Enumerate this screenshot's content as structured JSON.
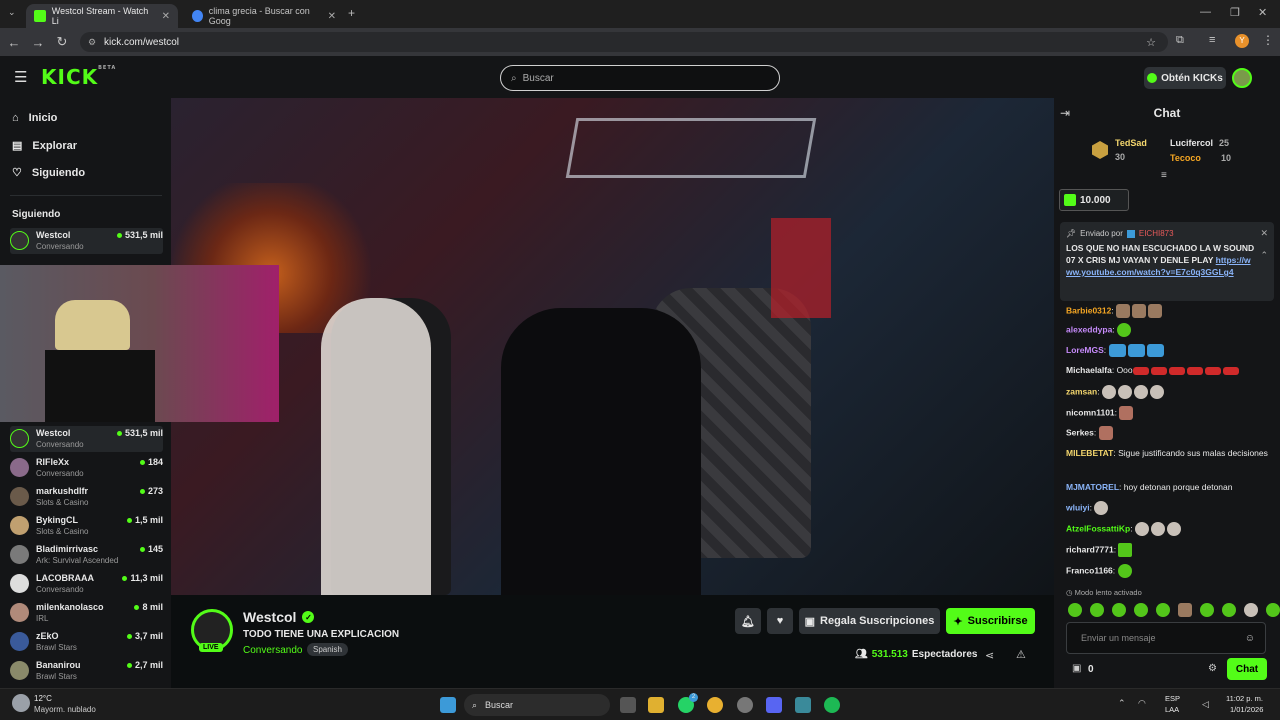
{
  "browser": {
    "tabs": [
      {
        "title": "Westcol Stream - Watch Li",
        "active": true
      },
      {
        "title": "clima grecia - Buscar con Goog",
        "active": false
      }
    ],
    "url": "kick.com/westcol",
    "profile_initial": "Y"
  },
  "header": {
    "logo": "KICK",
    "logo_badge": "BETA",
    "search_placeholder": "Buscar",
    "get_kicks": "Obtén KICKs"
  },
  "sidebar": {
    "nav": [
      {
        "label": "Inicio",
        "icon": "home-icon"
      },
      {
        "label": "Explorar",
        "icon": "compass-icon"
      },
      {
        "label": "Siguiendo",
        "icon": "heart-icon"
      }
    ],
    "following_header": "Siguiendo",
    "following": [
      {
        "name": "Westcol",
        "category": "Conversando",
        "viewers": "531,5 mil"
      },
      {
        "name": "Westcol",
        "category": "Conversando",
        "viewers": "531,5 mil"
      },
      {
        "name": "RIFleXx",
        "category": "Conversando",
        "viewers": "184"
      },
      {
        "name": "markushdlfr",
        "category": "Slots & Casino",
        "viewers": "273"
      },
      {
        "name": "BykingCL",
        "category": "Slots & Casino",
        "viewers": "1,5 mil"
      },
      {
        "name": "Bladimirrivasc",
        "category": "Ark: Survival Ascended",
        "viewers": "145"
      },
      {
        "name": "LACOBRAAA",
        "category": "Conversando",
        "viewers": "11,3 mil"
      },
      {
        "name": "milenkanolasco",
        "category": "IRL",
        "viewers": "8 mil"
      },
      {
        "name": "zEkO",
        "category": "Brawl Stars",
        "viewers": "3,7 mil"
      },
      {
        "name": "Bananirou",
        "category": "Brawl Stars",
        "viewers": "2,7 mil"
      }
    ]
  },
  "stream": {
    "streamer": "Westcol",
    "live": "LIVE",
    "title": "TODO TIENE UNA EXPLICACION",
    "category": "Conversando",
    "tag": "Spanish",
    "gift_subs": "Regala Suscripciones",
    "subscribe": "Suscribirse",
    "viewers": "531.513",
    "viewers_label": "Espectadores"
  },
  "chat": {
    "title": "Chat",
    "leaderboard": [
      {
        "name": "TedSad",
        "count": "30"
      },
      {
        "name": "Lucifercol",
        "count": "25"
      },
      {
        "name": "Tecoco",
        "count": "10"
      }
    ],
    "kicks_amount": "10.000",
    "pinned": {
      "by_label": "Enviado por",
      "user": "EICHI873",
      "text": "LOS QUE NO HAN ESCUCHADO LA W SOUND 07 X CRIS MJ VAYAN Y DENLE PLAY",
      "link": "https://www.youtube.com/watch?v=E7c0q3GGLg4"
    },
    "messages": [
      {
        "user": "Barbie0312",
        "color": "#f5a623",
        "text": "",
        "emotes": 3
      },
      {
        "user": "alexeddypa",
        "color": "#c58af9",
        "text": "",
        "emotes": 1
      },
      {
        "user": "LoreMGS",
        "color": "#c58af9",
        "text": "",
        "emotes": 3
      },
      {
        "user": "Michaelalfa",
        "color": "#e8e8e8",
        "text": "Ooo",
        "emotes": 6
      },
      {
        "user": "zamsan",
        "color": "#f5d76e",
        "text": "",
        "emotes": 4
      },
      {
        "user": "nicomn1101",
        "color": "#e8e8e8",
        "text": "",
        "emotes": 1
      },
      {
        "user": "Serkes",
        "color": "#e8e8e8",
        "text": "",
        "emotes": 1
      },
      {
        "user": "MILEBETAT",
        "color": "#f5d76e",
        "text": "Sigue justificando sus malas decisiones",
        "emotes": 0
      },
      {
        "user": "MJMATOREL",
        "color": "#8ab4f8",
        "text": "hoy detonan porque detonan",
        "emotes": 0
      },
      {
        "user": "wluiyi",
        "color": "#8ab4f8",
        "text": "",
        "emotes": 1
      },
      {
        "user": "AtzelFossattiKp",
        "color": "#53fc18",
        "text": "",
        "emotes": 3
      },
      {
        "user": "richard7771",
        "color": "#e8e8e8",
        "text": "",
        "emotes": 1
      },
      {
        "user": "Franco1166",
        "color": "#e8e8e8",
        "text": "",
        "emotes": 1
      }
    ],
    "slow_mode": "Modo lento activado",
    "input_placeholder": "Enviar un mensaje",
    "points": "0",
    "send_button": "Chat"
  },
  "taskbar": {
    "weather_temp": "12°C",
    "weather_desc": "Mayorm. nublado",
    "search": "Buscar",
    "lang": "ESP",
    "lang_sub": "LAA",
    "time": "11:02 p. m.",
    "date": "1/01/2026",
    "badge_count": "2"
  },
  "colors": {
    "accent": "#53fc18",
    "bg": "#0b0e0f",
    "panel": "#141517"
  }
}
